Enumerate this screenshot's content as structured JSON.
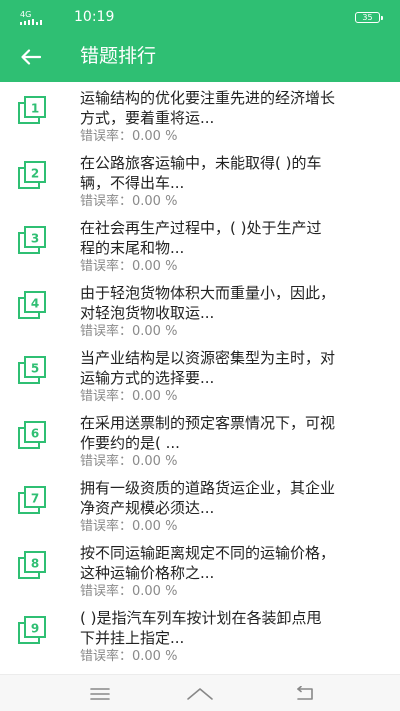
{
  "status": {
    "signal_label": "4G",
    "time": "10:19",
    "battery": "35"
  },
  "header": {
    "title": "错题排行",
    "back_icon": "arrow-left-icon"
  },
  "colors": {
    "primary": "#2fbf73",
    "text": "#222222",
    "muted": "#8a8a8a"
  },
  "questions": [
    {
      "rank": "1",
      "line1": "运输结构的优化要注重先进的经济增长",
      "line2": "方式，要着重将运...",
      "rate": "错误率：0.00 %"
    },
    {
      "rank": "2",
      "line1": "在公路旅客运输中，未能取得( )的车",
      "line2": "辆，不得出车...",
      "rate": "错误率：0.00 %"
    },
    {
      "rank": "3",
      "line1": "在社会再生产过程中，( )处于生产过",
      "line2": "程的末尾和物...",
      "rate": "错误率：0.00 %"
    },
    {
      "rank": "4",
      "line1": "由于轻泡货物体积大而重量小，因此，",
      "line2": "对轻泡货物收取运...",
      "rate": "错误率：0.00 %"
    },
    {
      "rank": "5",
      "line1": "当产业结构是以资源密集型为主时，对",
      "line2": "运输方式的选择要...",
      "rate": "错误率：0.00 %"
    },
    {
      "rank": "6",
      "line1": "在采用送票制的预定客票情况下，可视",
      "line2": "作要约的是( ...",
      "rate": "错误率：0.00 %"
    },
    {
      "rank": "7",
      "line1": "拥有一级资质的道路货运企业，其企业",
      "line2": "净资产规模必须达...",
      "rate": "错误率：0.00 %"
    },
    {
      "rank": "8",
      "line1": "按不同运输距离规定不同的运输价格，",
      "line2": "这种运输价格称之...",
      "rate": "错误率：0.00 %"
    },
    {
      "rank": "9",
      "line1": "( )是指汽车列车按计划在各装卸点甩",
      "line2": "下并挂上指定...",
      "rate": "错误率：0.00 %"
    }
  ],
  "navbar": {
    "items": [
      "menu-icon",
      "home-icon",
      "back-icon"
    ]
  }
}
